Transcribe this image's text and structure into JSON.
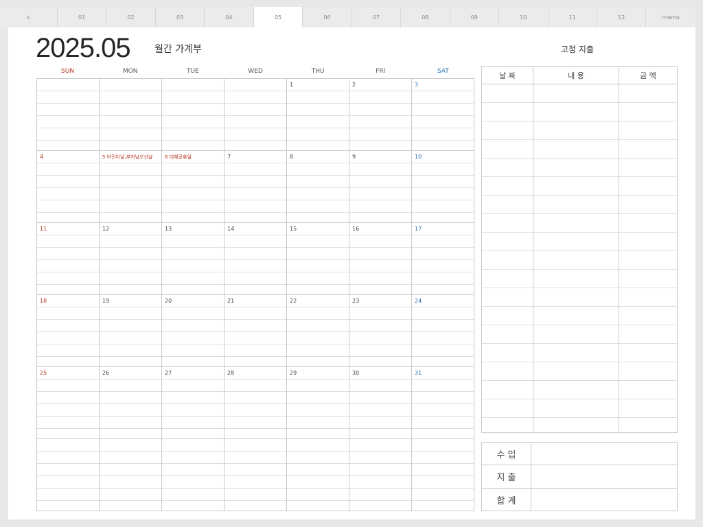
{
  "tabs": [
    "<",
    "01",
    "02",
    "03",
    "04",
    "05",
    "06",
    "07",
    "08",
    "09",
    "10",
    "11",
    "12",
    "memo"
  ],
  "active_tab": "05",
  "header": {
    "year_month": "2025.05",
    "subtitle": "월간 가계부"
  },
  "weekdays": [
    "SUN",
    "MON",
    "TUE",
    "WED",
    "THU",
    "FRI",
    "SAT"
  ],
  "calendar": {
    "weeks": [
      [
        "",
        "",
        "",
        "",
        "1",
        "2",
        "3"
      ],
      [
        "4",
        "5 어린이날,부처님오신날",
        "6 대체공휴일",
        "7",
        "8",
        "9",
        "10"
      ],
      [
        "11",
        "12",
        "13",
        "14",
        "15",
        "16",
        "17"
      ],
      [
        "18",
        "19",
        "20",
        "21",
        "22",
        "23",
        "24"
      ],
      [
        "25",
        "26",
        "27",
        "28",
        "29",
        "30",
        "31"
      ],
      [
        "",
        "",
        "",
        "",
        "",
        "",
        ""
      ]
    ],
    "holidays": [
      "5 어린이날,부처님오신날",
      "6 대체공휴일"
    ]
  },
  "fixed_expense": {
    "title": "고정 지출",
    "headers": [
      "날 짜",
      "내 용",
      "금 액"
    ]
  },
  "summary": {
    "rows": [
      "수 입",
      "지 출",
      "합 계"
    ]
  },
  "colors": {
    "sunday": "#b5301f",
    "saturday": "#2a6fb5",
    "grid": "#c8c8c8",
    "background": "#e8e8e8"
  }
}
